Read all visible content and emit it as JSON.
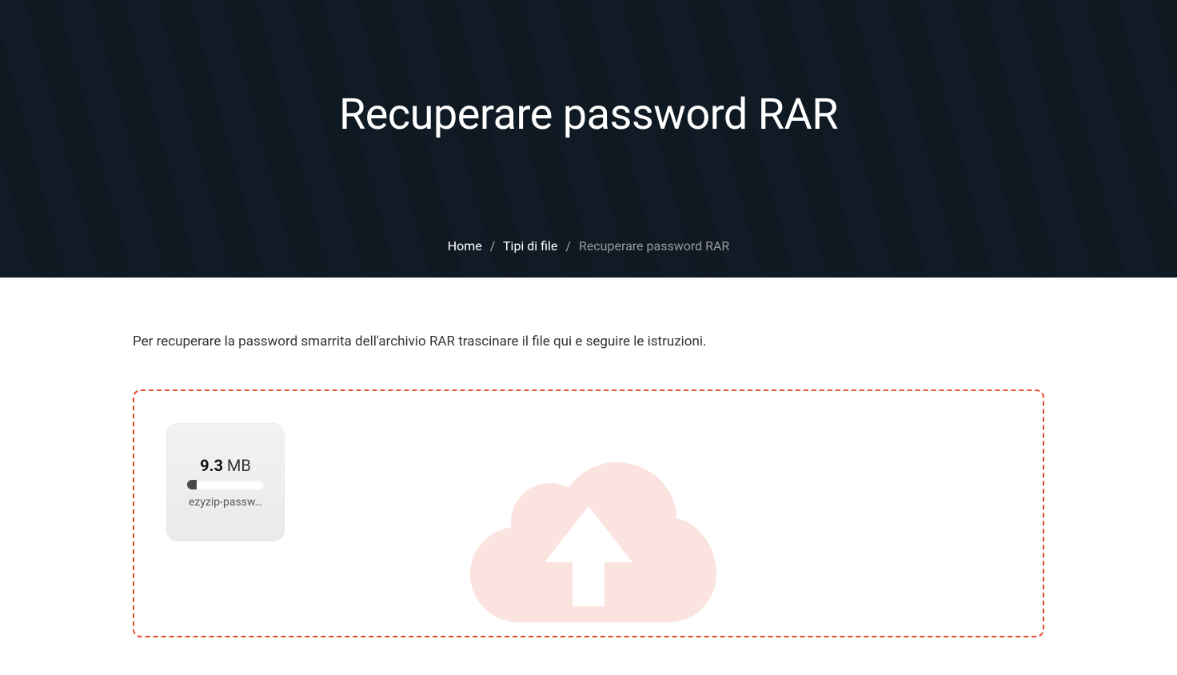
{
  "hero": {
    "title": "Recuperare password RAR"
  },
  "breadcrumb": {
    "home": "Home",
    "types": "Tipi di file",
    "current": "Recuperare password RAR",
    "sep": "/"
  },
  "content": {
    "instruction": "Per recuperare la password smarrita dell'archivio RAR trascinare il file qui e seguire le istruzioni."
  },
  "file": {
    "size_value": "9.3",
    "size_unit": " MB",
    "name": "ezyzip-passw…",
    "progress_percent": 12
  }
}
